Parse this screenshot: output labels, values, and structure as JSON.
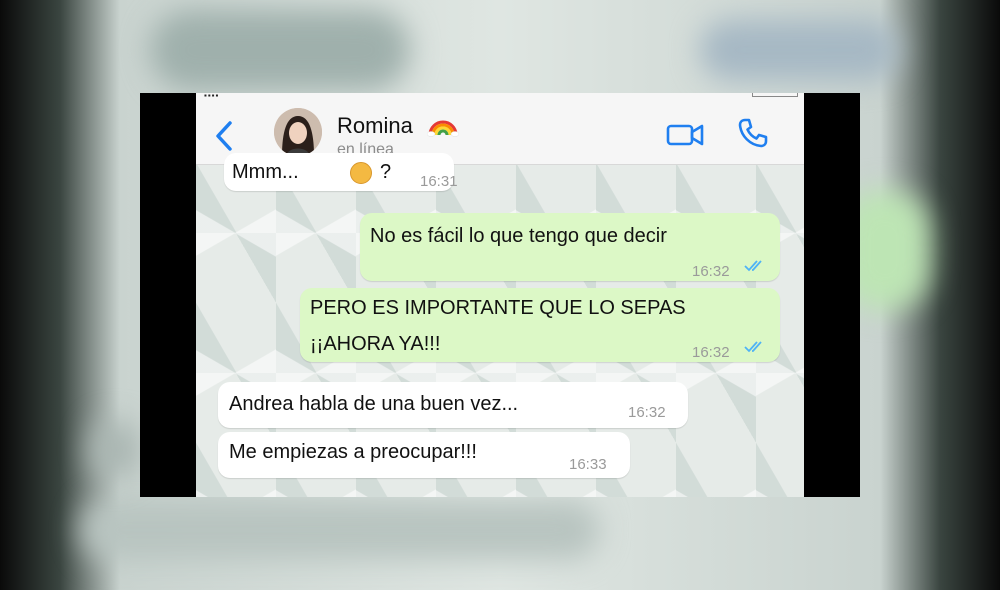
{
  "header": {
    "contact_name": "Romina",
    "contact_status": "en línea"
  },
  "icons": {
    "back": "chevron-left-icon",
    "avatar": "avatar",
    "name_emoji": "rainbow-icon",
    "video": "video-camera-icon",
    "call": "phone-icon",
    "read_receipt": "double-check-icon",
    "partial_emoji": "emoji-icon"
  },
  "colors": {
    "accent": "#1f7ff0",
    "outgoing_bubble": "#dcf8c6",
    "incoming_bubble": "#ffffff",
    "read_ticks": "#4fb3f6"
  },
  "messages": [
    {
      "direction": "in",
      "text": "Mmm...",
      "text_after_emoji": "?",
      "time": "16:31"
    },
    {
      "direction": "out",
      "text": "No es fácil lo que tengo que decir",
      "time": "16:32",
      "status": "read"
    },
    {
      "direction": "out",
      "text": "PERO ES IMPORTANTE QUE LO SEPAS\n¡¡AHORA YA!!!",
      "time": "16:32",
      "status": "read"
    },
    {
      "direction": "in",
      "text": "Andrea habla de una buen vez...",
      "time": "16:32"
    },
    {
      "direction": "in",
      "text": "Me empiezas a preocupar!!!",
      "time": "16:33"
    }
  ]
}
